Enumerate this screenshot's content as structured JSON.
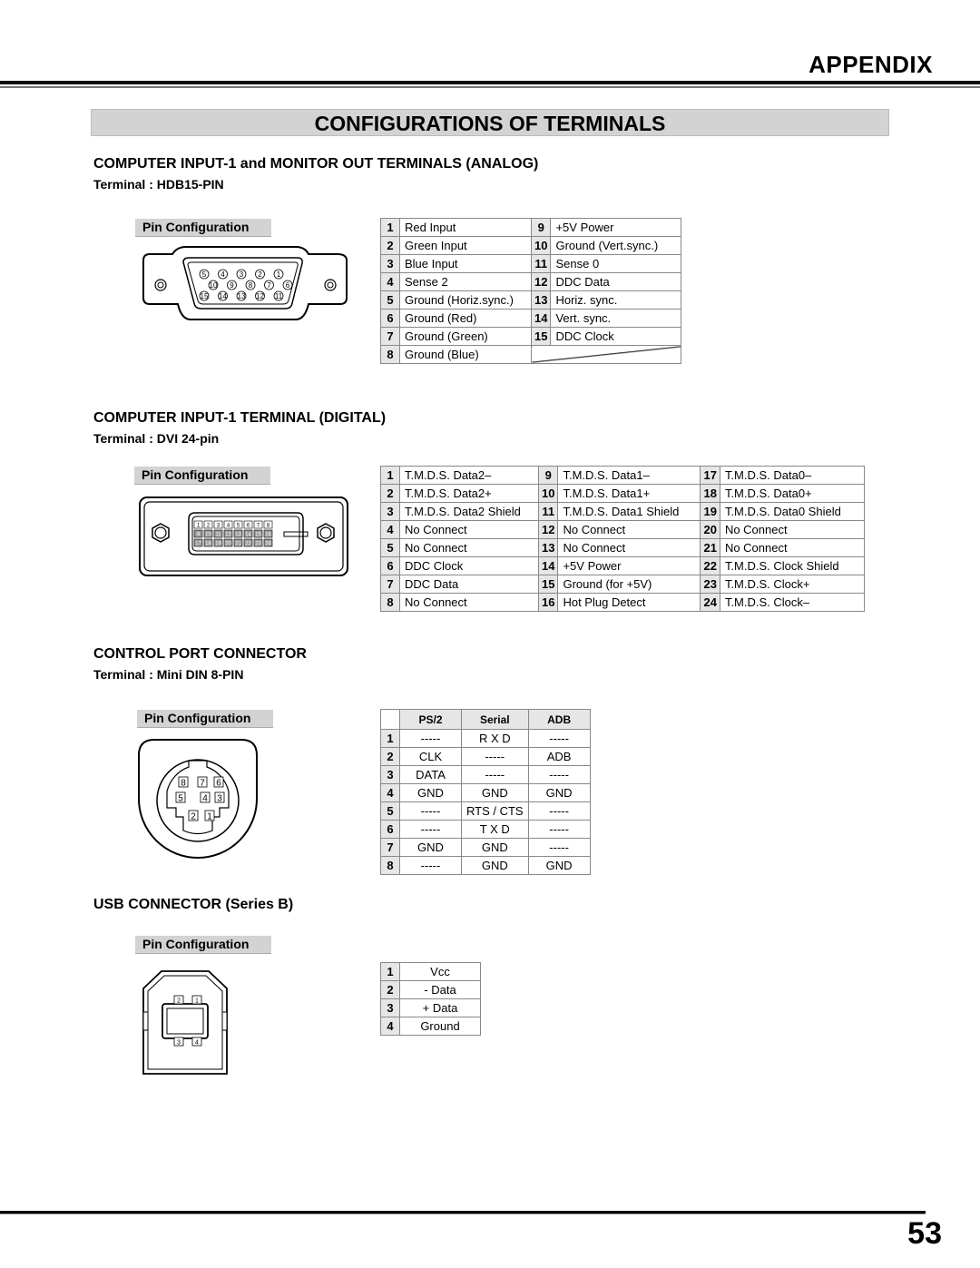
{
  "header": {
    "section": "APPENDIX",
    "title": "CONFIGURATIONS OF TERMINALS"
  },
  "sections": {
    "analog": {
      "heading": "COMPUTER INPUT-1 and MONITOR OUT TERMINALS (ANALOG)",
      "terminal": "Terminal : HDB15-PIN",
      "pin_config_label": "Pin Configuration",
      "rows": [
        [
          "1",
          "Red Input",
          "9",
          "+5V Power"
        ],
        [
          "2",
          "Green Input",
          "10",
          "Ground (Vert.sync.)"
        ],
        [
          "3",
          "Blue Input",
          "11",
          "Sense 0"
        ],
        [
          "4",
          "Sense 2",
          "12",
          "DDC Data"
        ],
        [
          "5",
          "Ground (Horiz.sync.)",
          "13",
          "Horiz. sync."
        ],
        [
          "6",
          "Ground (Red)",
          "14",
          "Vert. sync."
        ],
        [
          "7",
          "Ground (Green)",
          "15",
          "DDC Clock"
        ],
        [
          "8",
          "Ground (Blue)",
          "",
          ""
        ]
      ],
      "diagram_pins": [
        [
          "5",
          "4",
          "3",
          "2",
          "1"
        ],
        [
          "10",
          "9",
          "8",
          "7",
          "6"
        ],
        [
          "15",
          "14",
          "13",
          "12",
          "11"
        ]
      ]
    },
    "digital": {
      "heading": "COMPUTER INPUT-1 TERMINAL (DIGITAL)",
      "terminal": "Terminal : DVI 24-pin",
      "pin_config_label": "Pin Configuration",
      "rows": [
        [
          "1",
          "T.M.D.S. Data2–",
          "9",
          "T.M.D.S. Data1–",
          "17",
          "T.M.D.S. Data0–"
        ],
        [
          "2",
          "T.M.D.S. Data2+",
          "10",
          "T.M.D.S. Data1+",
          "18",
          "T.M.D.S. Data0+"
        ],
        [
          "3",
          "T.M.D.S. Data2 Shield",
          "11",
          "T.M.D.S. Data1 Shield",
          "19",
          "T.M.D.S. Data0 Shield"
        ],
        [
          "4",
          "No Connect",
          "12",
          "No Connect",
          "20",
          "No Connect"
        ],
        [
          "5",
          "No Connect",
          "13",
          "No Connect",
          "21",
          "No Connect"
        ],
        [
          "6",
          "DDC Clock",
          "14",
          "+5V Power",
          "22",
          "T.M.D.S. Clock Shield"
        ],
        [
          "7",
          "DDC Data",
          "15",
          "Ground (for +5V)",
          "23",
          "T.M.D.S. Clock+"
        ],
        [
          "8",
          "No Connect",
          "16",
          "Hot Plug Detect",
          "24",
          "T.M.D.S. Clock–"
        ]
      ]
    },
    "control": {
      "heading": "CONTROL PORT CONNECTOR",
      "terminal": "Terminal : Mini DIN 8-PIN",
      "pin_config_label": "Pin Configuration",
      "columns": [
        "",
        "PS/2",
        "Serial",
        "ADB"
      ],
      "rows": [
        [
          "1",
          "-----",
          "R X D",
          "-----"
        ],
        [
          "2",
          "CLK",
          "-----",
          "ADB"
        ],
        [
          "3",
          "DATA",
          "-----",
          "-----"
        ],
        [
          "4",
          "GND",
          "GND",
          "GND"
        ],
        [
          "5",
          "-----",
          "RTS / CTS",
          "-----"
        ],
        [
          "6",
          "-----",
          "T X D",
          "-----"
        ],
        [
          "7",
          "GND",
          "GND",
          "-----"
        ],
        [
          "8",
          "-----",
          "GND",
          "GND"
        ]
      ]
    },
    "usb": {
      "heading": "USB CONNECTOR (Series B)",
      "pin_config_label": "Pin Configuration",
      "rows": [
        [
          "1",
          "Vcc"
        ],
        [
          "2",
          "- Data"
        ],
        [
          "3",
          "+ Data"
        ],
        [
          "4",
          "Ground"
        ]
      ]
    }
  },
  "footer": {
    "page_number": "53"
  }
}
